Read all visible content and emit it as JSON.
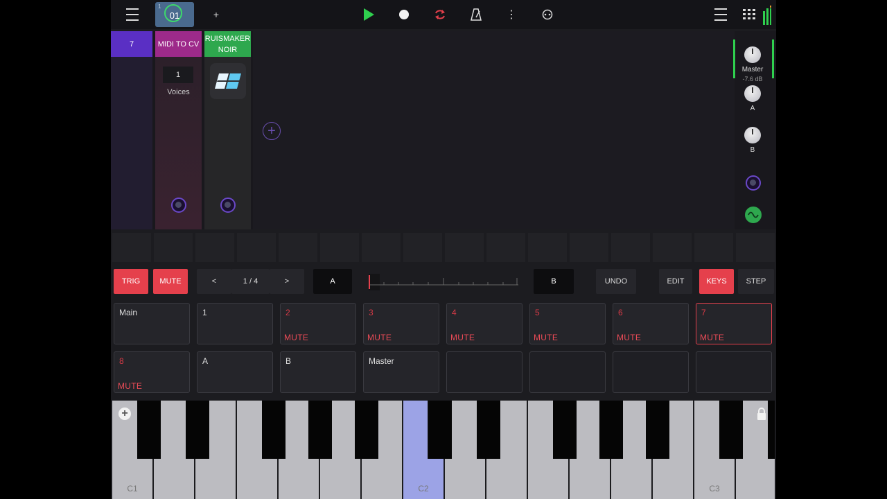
{
  "topbar": {
    "scene_number": "01",
    "scene_sub": "1",
    "add_label": "+"
  },
  "tracks": [
    {
      "label": "7",
      "color": "#5a2fc4",
      "body": "#221d30"
    },
    {
      "label": "MIDI TO CV",
      "color": "#9d2a8a",
      "body": "#3a2230",
      "voices_value": "1",
      "voices_label": "Voices"
    },
    {
      "label_line1": "RUISMAKER",
      "label_line2": "NOIR",
      "color": "#2ea84e",
      "body": "#262628"
    }
  ],
  "mixer": {
    "master_label": "Master",
    "master_db": "-7.6 dB",
    "a_label": "A",
    "b_label": "B"
  },
  "controls": {
    "trig": "TRIG",
    "mute": "MUTE",
    "prev": "<",
    "page": "1 / 4",
    "next": ">",
    "a": "A",
    "b": "B",
    "undo": "UNDO",
    "edit": "EDIT",
    "keys": "KEYS",
    "step": "STEP",
    "accent": "#e5404c"
  },
  "channels": [
    {
      "num": "Main",
      "muted": false,
      "mute_label": ""
    },
    {
      "num": "1",
      "muted": false,
      "mute_label": ""
    },
    {
      "num": "2",
      "muted": true,
      "mute_label": "MUTE"
    },
    {
      "num": "3",
      "muted": true,
      "mute_label": "MUTE"
    },
    {
      "num": "4",
      "muted": true,
      "mute_label": "MUTE"
    },
    {
      "num": "5",
      "muted": true,
      "mute_label": "MUTE"
    },
    {
      "num": "6",
      "muted": true,
      "mute_label": "MUTE"
    },
    {
      "num": "7",
      "muted": true,
      "mute_label": "MUTE",
      "selected": true
    },
    {
      "num": "8",
      "muted": true,
      "mute_label": "MUTE"
    },
    {
      "num": "A",
      "muted": false,
      "mute_label": ""
    },
    {
      "num": "B",
      "muted": false,
      "mute_label": ""
    },
    {
      "num": "Master",
      "muted": false,
      "mute_label": ""
    }
  ],
  "keyboard": {
    "labels": {
      "c1": "C1",
      "c2": "C2",
      "c3": "C3"
    },
    "active_key": "C2",
    "active_color": "#9ca3e6"
  }
}
